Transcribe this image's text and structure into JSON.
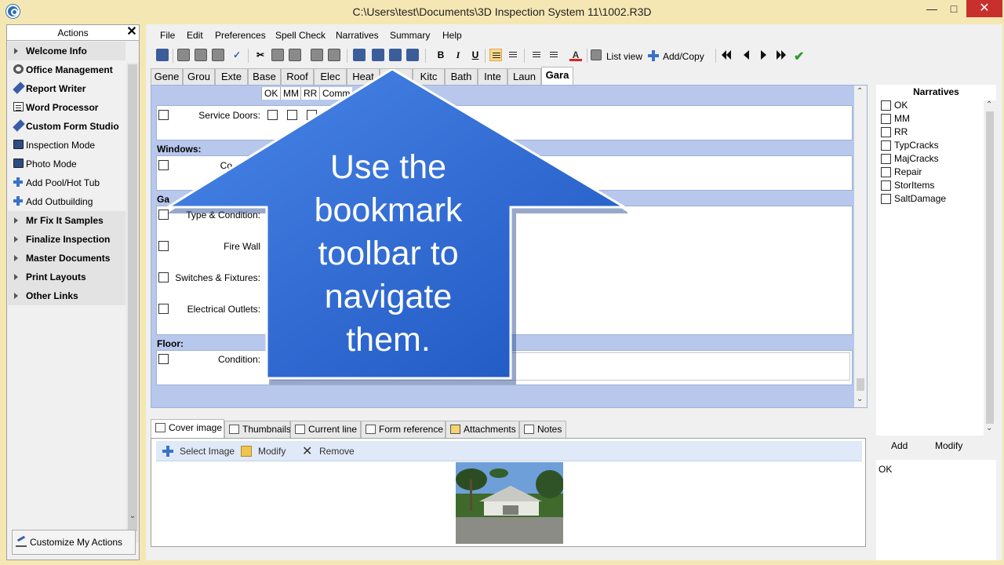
{
  "window": {
    "title": "C:\\Users\\test\\Documents\\3D Inspection System 11\\1002.R3D"
  },
  "actions": {
    "header": "Actions",
    "items": [
      {
        "label": "Welcome Info",
        "kind": "group",
        "icon": "triangle-icon"
      },
      {
        "label": "Office Management",
        "kind": "bold",
        "icon": "gear-icon"
      },
      {
        "label": "Report Writer",
        "kind": "bold",
        "icon": "pen-icon"
      },
      {
        "label": "Word Processor",
        "kind": "bold",
        "icon": "document-icon"
      },
      {
        "label": "Custom Form Studio",
        "kind": "bold",
        "icon": "pen-icon"
      },
      {
        "label": "Inspection Mode",
        "kind": "plain",
        "icon": "monitor-icon"
      },
      {
        "label": "Photo Mode",
        "kind": "plain",
        "icon": "monitor-icon"
      },
      {
        "label": "Add Pool/Hot Tub",
        "kind": "plain",
        "icon": "plus-icon"
      },
      {
        "label": "Add Outbuilding",
        "kind": "plain",
        "icon": "plus-icon"
      },
      {
        "label": "Mr Fix It Samples",
        "kind": "group",
        "icon": "triangle-icon"
      },
      {
        "label": "Finalize Inspection",
        "kind": "group",
        "icon": "triangle-icon"
      },
      {
        "label": "Master Documents",
        "kind": "group",
        "icon": "triangle-icon"
      },
      {
        "label": "Print Layouts",
        "kind": "group",
        "icon": "triangle-icon"
      },
      {
        "label": "Other Links",
        "kind": "group",
        "icon": "triangle-icon"
      }
    ],
    "customize": "Customize My Actions"
  },
  "menu": [
    "File",
    "Edit",
    "Preferences",
    "Spell Check",
    "Narratives",
    "Summary",
    "Help"
  ],
  "toolbar": {
    "bold": "B",
    "italic": "I",
    "underline": "U",
    "font_color": "A",
    "list_view": "List view",
    "add_copy": "Add/Copy"
  },
  "tabs": [
    "Gene",
    "Grou",
    "Exte",
    "Base",
    "Roof",
    "Elec",
    "Heat",
    "Inte",
    "Kitc",
    "Bath",
    "Inte",
    "Laun",
    "Gara"
  ],
  "form": {
    "columns": [
      "OK",
      "MM",
      "RR",
      "Comm"
    ],
    "rows": {
      "service_doors": "Service Doors:",
      "windows": "Windows:",
      "windows_condition": "Co",
      "garage_initial": "Ga",
      "type_condition": "Type & Condition:",
      "fire_wall": "Fire Wall",
      "switches": "Switches & Fixtures:",
      "outlets": "Electrical Outlets:",
      "floor": "Floor:",
      "floor_condition": "Condition:"
    }
  },
  "overlay": {
    "lines": [
      "Use the",
      "bookmark",
      "toolbar to",
      "navigate",
      "them."
    ],
    "color": "#2f6fd6"
  },
  "bottom_tabs": [
    "Cover image",
    "Thumbnails",
    "Current line",
    "Form reference",
    "Attachments",
    "Notes"
  ],
  "bottom_toolbar": {
    "select_image": "Select Image",
    "modify": "Modify",
    "remove": "Remove"
  },
  "narratives": {
    "title": "Narratives",
    "items": [
      "OK",
      "MM",
      "RR",
      "TypCracks",
      "MajCracks",
      "Repair",
      "StorItems",
      "SaltDamage"
    ],
    "add": "Add",
    "modify": "Modify",
    "selected_text": "OK"
  }
}
